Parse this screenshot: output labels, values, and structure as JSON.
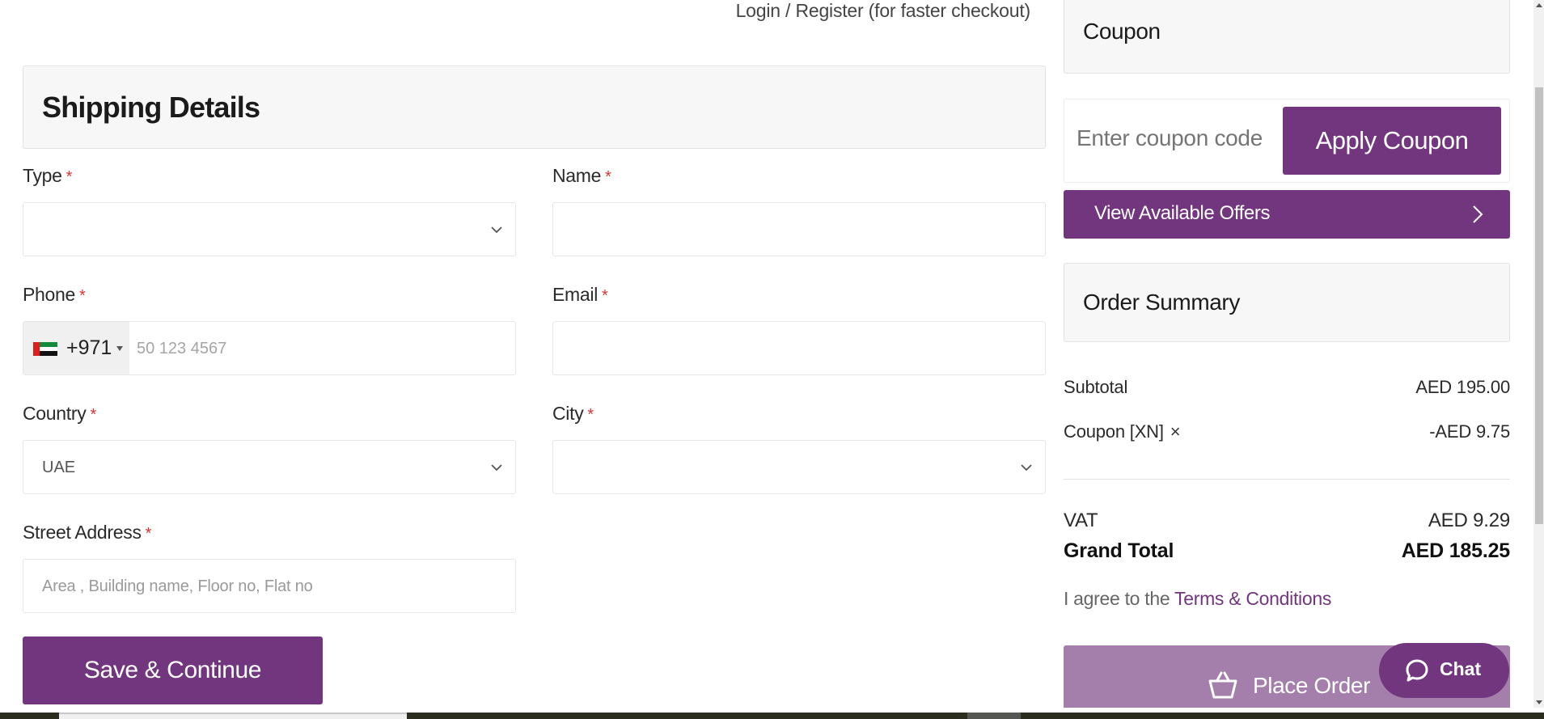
{
  "header": {
    "login_link": "Login / Register (for faster checkout)"
  },
  "shipping": {
    "title": "Shipping Details",
    "fields": {
      "type": {
        "label": "Type",
        "required_mark": "*",
        "value": ""
      },
      "name": {
        "label": "Name",
        "required_mark": "*",
        "value": ""
      },
      "phone": {
        "label": "Phone",
        "required_mark": "*",
        "country_flag": "UAE",
        "dial_code": "+971",
        "placeholder": "50 123 4567",
        "value": ""
      },
      "email": {
        "label": "Email",
        "required_mark": "*",
        "value": ""
      },
      "country": {
        "label": "Country",
        "required_mark": "*",
        "value": "UAE"
      },
      "city": {
        "label": "City",
        "required_mark": "*",
        "value": ""
      },
      "street": {
        "label": "Street Address",
        "required_mark": "*",
        "placeholder": "Area , Building name, Floor no, Flat no",
        "value": ""
      }
    },
    "save_button": "Save & Continue"
  },
  "coupon": {
    "title": "Coupon",
    "input_placeholder": "Enter coupon code",
    "apply_button": "Apply Coupon",
    "offers_button": "View Available Offers"
  },
  "summary": {
    "title": "Order Summary",
    "subtotal_label": "Subtotal",
    "subtotal_value": "AED 195.00",
    "coupon_label": "Coupon [XN]",
    "coupon_remove_icon": "×",
    "coupon_value": "-AED 9.75",
    "vat_label": "VAT",
    "vat_value": "AED 9.29",
    "grand_total_label": "Grand Total",
    "grand_total_value": "AED 185.25",
    "terms_prefix": "I agree to the ",
    "terms_link": "Terms & Conditions",
    "place_order_button": "Place Order"
  },
  "chat": {
    "label": "Chat"
  },
  "colors": {
    "brand_purple": "#72367e",
    "place_order_disabled": "#a47fac",
    "required_red": "#dd3333",
    "header_gray": "#f7f7f7"
  },
  "icons": {
    "select_chevron": "chevron-down-icon",
    "offers_arrow": "chevron-right-icon",
    "basket": "basket-icon",
    "chat": "chat-bubble-icon",
    "coupon_remove": "close-icon",
    "flag": "uae-flag-icon",
    "dial_caret": "caret-down-icon"
  }
}
